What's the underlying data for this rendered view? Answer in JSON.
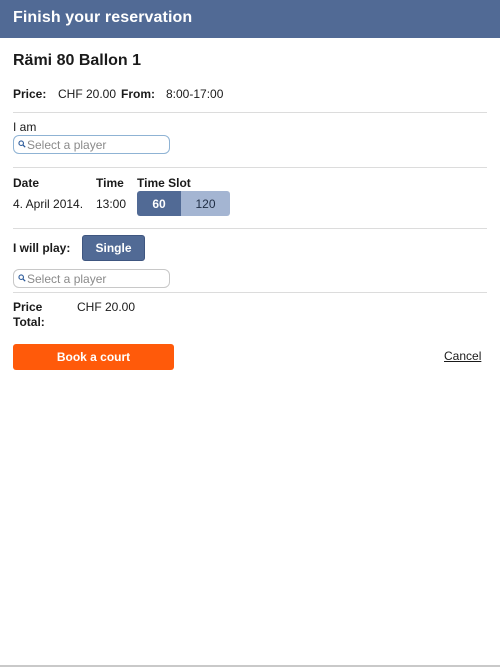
{
  "header": {
    "title": "Finish your reservation"
  },
  "court": {
    "name": "Rämi 80 Ballon 1"
  },
  "info": {
    "price_label": "Price:",
    "price_value": "CHF 20.00",
    "from_label": "From:",
    "from_value": "8:00-17:00"
  },
  "player_self": {
    "label": "I am",
    "placeholder": "Select a player",
    "value": ""
  },
  "schedule": {
    "date_header": "Date",
    "time_header": "Time",
    "slot_header": "Time Slot",
    "date_value": "4. April 2014.",
    "time_value": "13:00",
    "slot_options": [
      "60",
      "120"
    ],
    "slot_selected": "60"
  },
  "play_mode": {
    "label": "I will play:",
    "button": "Single"
  },
  "player_partner": {
    "placeholder": "Select a player",
    "value": ""
  },
  "total": {
    "label": "Price Total:",
    "value": "CHF 20.00"
  },
  "actions": {
    "book": "Book a court",
    "cancel": "Cancel"
  },
  "colors": {
    "header_bg": "#516a95",
    "accent_orange": "#ff5a0a",
    "segment_active": "#516a95",
    "segment_inactive": "#a4b5d2"
  },
  "icons": [
    "search-icon"
  ]
}
